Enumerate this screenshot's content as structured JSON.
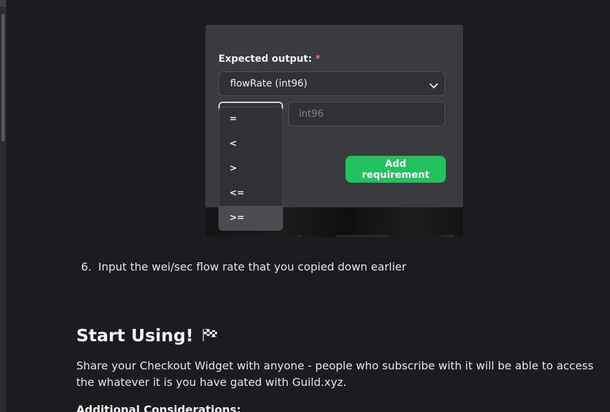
{
  "embed": {
    "label": "Expected output:",
    "required_mark": "*",
    "output_select_value": "flowRate (int96)",
    "operator_select_value": ">=",
    "value_placeholder": "int96",
    "add_button_label": "Add requirement",
    "operator_options": [
      "=",
      "<",
      ">",
      "<=",
      ">="
    ],
    "selected_option_index": 4
  },
  "article": {
    "step_number": "6.",
    "step_text": "Input the wei/sec flow rate that you copied down earlier",
    "heading": "Start Using!",
    "heading_icon": "checkered-flag-icon",
    "paragraph": "Share your Checkout Widget with anyone - people who subscribe with it will be able to access the whatever it is you have gated with Guild.xyz.",
    "subheading": "Additional Considerations:"
  },
  "colors": {
    "background": "#1b1c1f",
    "accent_button": "#22c35e",
    "required_mark": "#f16b6b"
  }
}
